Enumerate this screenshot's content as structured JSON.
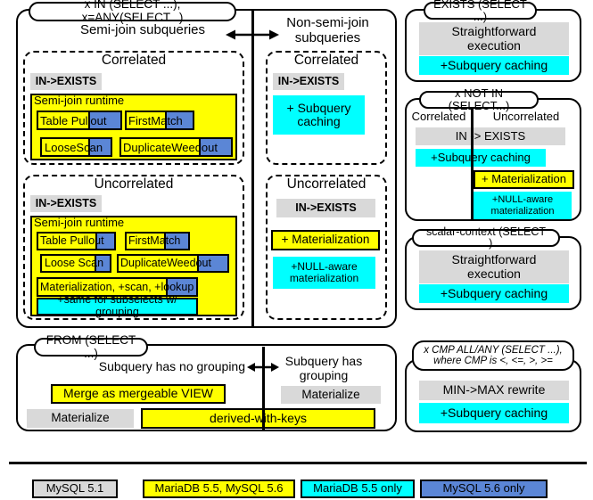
{
  "title_top_left": "x IN (SELECT ...), x=ANY(SELECT...)",
  "branch_left_label": "Semi-join subqueries",
  "branch_right_label": "Non-semi-join\nsubqueries",
  "semijoin": {
    "correlated": {
      "heading": "Correlated",
      "in_exists": "IN->EXISTS",
      "runtime_title": "Semi-join runtime",
      "strategies": [
        "Table Pullout",
        "FirstMatch",
        "LooseScan",
        "DuplicateWeedout"
      ]
    },
    "uncorrelated": {
      "heading": "Uncorrelated",
      "in_exists": "IN->EXISTS",
      "runtime_title": "Semi-join runtime",
      "strategies": [
        "Table Pullout",
        "FirstMatch",
        "Loose Scan",
        "DuplicateWeedout"
      ],
      "materialization": "Materialization, +scan, +lookup",
      "subselects": "+same for subselects w/ grouping"
    }
  },
  "nonsemijoin": {
    "correlated": {
      "heading": "Correlated",
      "in_exists": "IN->EXISTS",
      "caching": "+ Subquery\ncaching"
    },
    "uncorrelated": {
      "heading": "Uncorrelated",
      "in_exists": "IN->EXISTS",
      "materialization": "+ Materialization",
      "null_aware": "+NULL-aware\nmaterialization"
    }
  },
  "exists_panel": {
    "title": "EXISTS (SELECT ...)",
    "straightforward": "Straightforward\nexecution",
    "caching": "+Subquery caching"
  },
  "not_in_panel": {
    "title": "x NOT IN (SELECT...)",
    "col_left": "Correlated",
    "col_right": "Uncorrelated",
    "in_exists": "IN -> EXISTS",
    "caching": "+Subquery caching",
    "materialization": "+ Materialization",
    "null_aware": "+NULL-aware\nmaterialization"
  },
  "scalar_panel": {
    "title": "scalar-context (SELECT ...)",
    "straightforward": "Straightforward\nexecution",
    "caching": "+Subquery caching"
  },
  "cmp_panel": {
    "title": "x CMP ALL/ANY (SELECT ...),\nwhere CMP is <, <=, >, >=",
    "rewrite": "MIN->MAX rewrite",
    "caching": "+Subquery caching"
  },
  "from_panel": {
    "title": "FROM (SELECT ...)",
    "left_label": "Subquery has no grouping",
    "right_label": "Subquery has\ngrouping",
    "merge_view": "Merge as mergeable VIEW",
    "materialize_left": "Materialize",
    "materialize_right": "Materialize",
    "derived_with_keys": "derived-with-keys"
  },
  "legend": [
    {
      "label": "MySQL 5.1",
      "color": "#d9d9d9"
    },
    {
      "label": "MariaDB 5.5, MySQL 5.6",
      "color": "#ffff00"
    },
    {
      "label": "MariaDB 5.5 only",
      "color": "#00ffff"
    },
    {
      "label": "MySQL 5.6 only",
      "color": "#5b86d6"
    }
  ]
}
